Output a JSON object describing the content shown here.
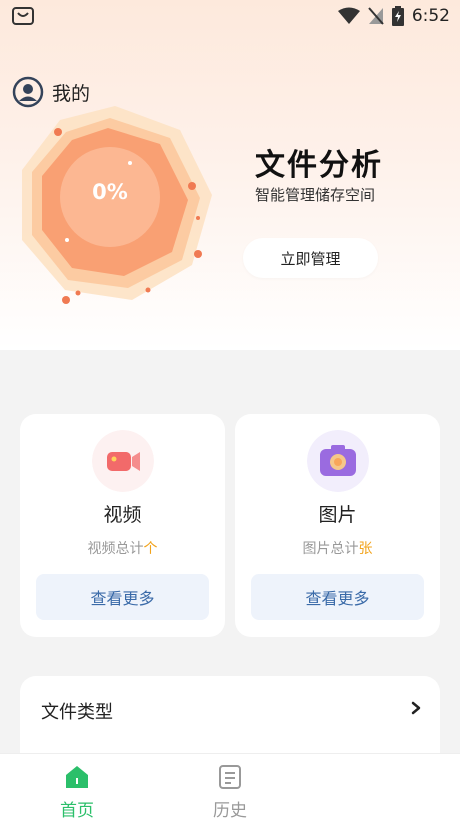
{
  "status_bar": {
    "time": "6:52"
  },
  "header": {
    "user_label": "我的"
  },
  "analysis": {
    "percent": "0%",
    "title": "文件分析",
    "subtitle": "智能管理储存空间",
    "button_label": "立即管理",
    "progress_fraction": 0
  },
  "cards": {
    "video": {
      "title": "视频",
      "stat_prefix": "视频总计",
      "stat_unit": "个",
      "button_label": "查看更多"
    },
    "image": {
      "title": "图片",
      "stat_prefix": "图片总计",
      "stat_unit": "张",
      "button_label": "查看更多"
    }
  },
  "file_types": {
    "title": "文件类型"
  },
  "tabs": [
    {
      "label": "首页",
      "icon": "home-icon",
      "active": true
    },
    {
      "label": "历史",
      "icon": "history-icon",
      "active": false
    }
  ],
  "colors": {
    "accent_green": "#2bbf6a",
    "accent_orange": "#f58a5f",
    "unit_highlight": "#f2a31b",
    "button_text_blue": "#3a6aa8"
  }
}
